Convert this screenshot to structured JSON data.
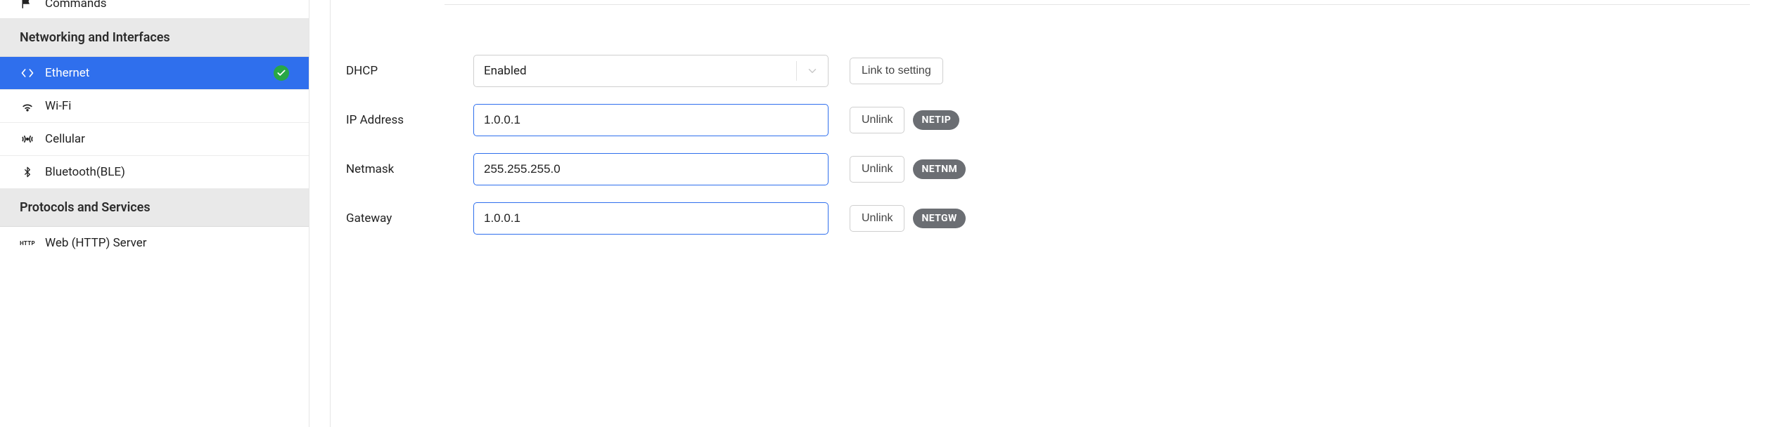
{
  "sidebar": {
    "truncated_item": {
      "label": "Commands"
    },
    "section_net": {
      "title": "Networking and Interfaces"
    },
    "items_net": [
      {
        "label": "Ethernet",
        "active": true,
        "status_ok": true
      },
      {
        "label": "Wi-Fi"
      },
      {
        "label": "Cellular"
      },
      {
        "label": "Bluetooth(BLE)"
      }
    ],
    "section_proto": {
      "title": "Protocols and Services"
    },
    "items_proto": [
      {
        "label": "Web (HTTP) Server"
      }
    ]
  },
  "form": {
    "dhcp": {
      "label": "DHCP",
      "value": "Enabled",
      "action": "Link to setting"
    },
    "ip": {
      "label": "IP Address",
      "value": "1.0.0.1",
      "action": "Unlink",
      "badge": "NETIP"
    },
    "netmask": {
      "label": "Netmask",
      "value": "255.255.255.0",
      "action": "Unlink",
      "badge": "NETNM"
    },
    "gateway": {
      "label": "Gateway",
      "value": "1.0.0.1",
      "action": "Unlink",
      "badge": "NETGW"
    }
  }
}
